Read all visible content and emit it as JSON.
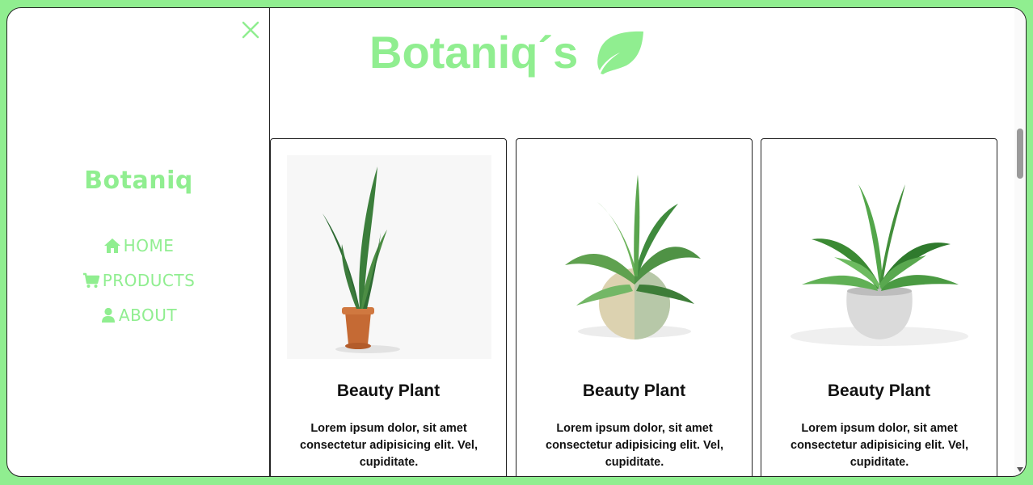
{
  "sidebar": {
    "brand": "Botaniq",
    "nav": [
      {
        "label": "HOME",
        "icon": "home-icon"
      },
      {
        "label": "PRODUCTS",
        "icon": "cart-icon"
      },
      {
        "label": "ABOUT",
        "icon": "user-icon"
      }
    ]
  },
  "header": {
    "logo_text": "Botaniq´s",
    "logo_icon": "leaf-icon"
  },
  "products": [
    {
      "title": "Beauty Plant",
      "description": "Lorem ipsum dolor, sit amet consectetur adipisicing elit. Vel, cupiditate."
    },
    {
      "title": "Beauty Plant",
      "description": "Lorem ipsum dolor, sit amet consectetur adipisicing elit. Vel, cupiditate."
    },
    {
      "title": "Beauty Plant",
      "description": "Lorem ipsum dolor, sit amet consectetur adipisicing elit. Vel, cupiditate."
    }
  ],
  "colors": {
    "accent": "#90ee90",
    "text": "#111111",
    "border": "#222222"
  }
}
